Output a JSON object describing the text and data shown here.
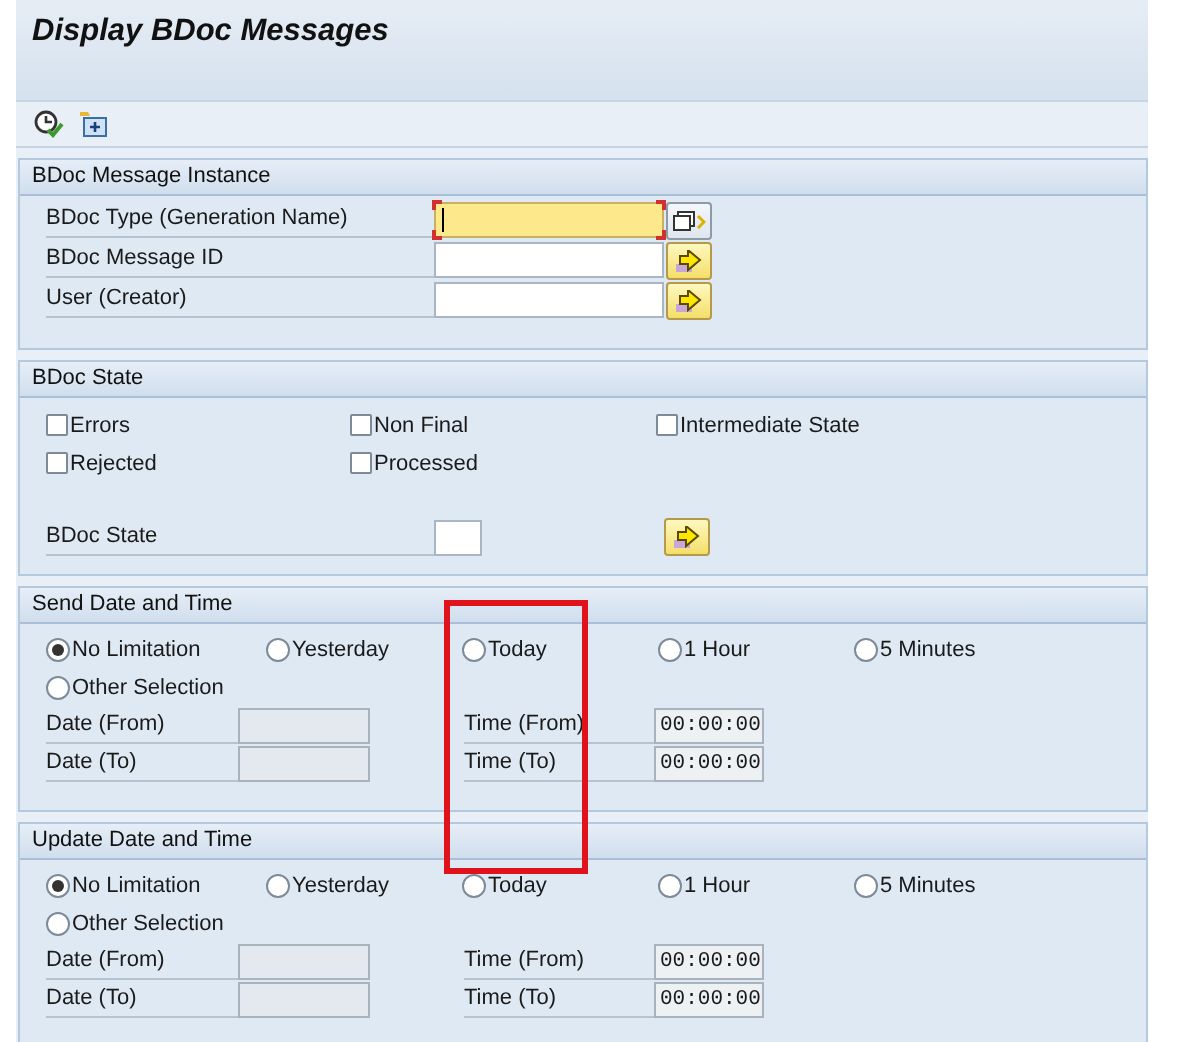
{
  "window": {
    "title": "Display BDoc Messages"
  },
  "instance": {
    "title": "BDoc Message Instance",
    "fields": [
      {
        "label": "BDoc Type (Generation Name)",
        "focused": true,
        "kind": "multiple"
      },
      {
        "label": "BDoc Message ID",
        "focused": false,
        "kind": "arrow"
      },
      {
        "label": "User (Creator)",
        "focused": false,
        "kind": "arrow"
      }
    ]
  },
  "state": {
    "title": "BDoc State",
    "checkboxes": [
      {
        "label": "Errors",
        "checked": false
      },
      {
        "label": "Non Final",
        "checked": false
      },
      {
        "label": "Intermediate State",
        "checked": false
      },
      {
        "label": "Rejected",
        "checked": false
      },
      {
        "label": "Processed",
        "checked": false
      }
    ],
    "field": {
      "label": "BDoc State"
    }
  },
  "send": {
    "title": "Send Date and Time",
    "options": [
      {
        "label": "No Limitation",
        "selected": true
      },
      {
        "label": "Yesterday",
        "selected": false
      },
      {
        "label": "Today",
        "selected": false
      },
      {
        "label": "1 Hour",
        "selected": false
      },
      {
        "label": "5 Minutes",
        "selected": false
      },
      {
        "label": "Other Selection",
        "selected": false
      }
    ],
    "rows": [
      {
        "date_label": "Date (From)",
        "time_label": "Time (From)",
        "time": "00:00:00"
      },
      {
        "date_label": "Date (To)",
        "time_label": "Time (To)",
        "time": "00:00:00"
      }
    ]
  },
  "update": {
    "title": "Update Date and Time",
    "options": [
      {
        "label": "No Limitation",
        "selected": true
      },
      {
        "label": "Yesterday",
        "selected": false
      },
      {
        "label": "Today",
        "selected": false
      },
      {
        "label": "1 Hour",
        "selected": false
      },
      {
        "label": "5 Minutes",
        "selected": false
      },
      {
        "label": "Other Selection",
        "selected": false
      }
    ],
    "rows": [
      {
        "date_label": "Date (From)",
        "time_label": "Time (From)",
        "time": "00:00:00"
      },
      {
        "date_label": "Date (To)",
        "time_label": "Time (To)",
        "time": "00:00:00"
      }
    ]
  }
}
